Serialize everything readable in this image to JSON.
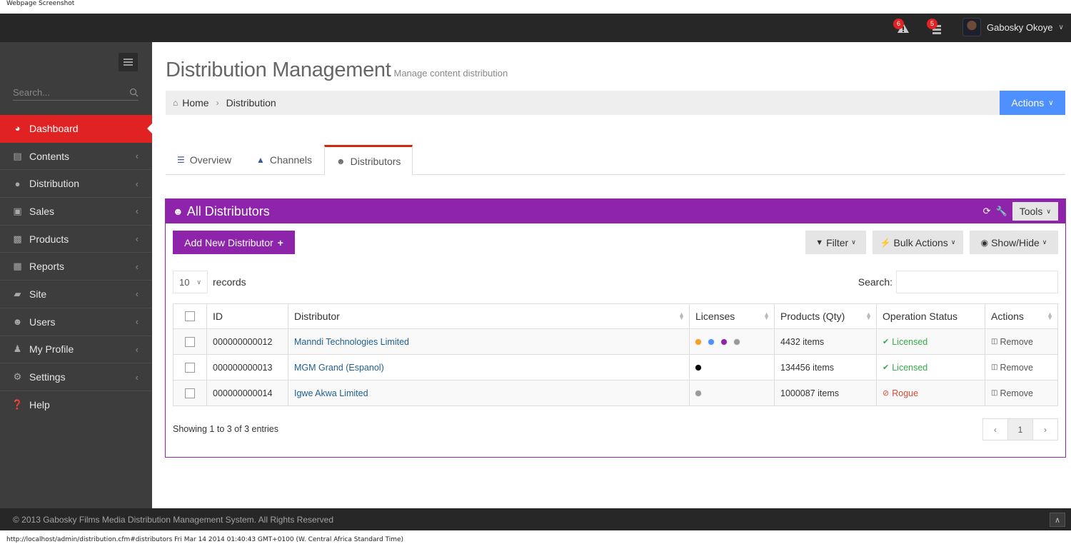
{
  "capture": {
    "top_label": "Webpage Screenshot",
    "bottom_label": "http://localhost/admin/distribution.cfm#distributors Fri Mar 14 2014 01:40:43 GMT+0100 (W. Central Africa Standard Time)"
  },
  "topbar": {
    "alerts_count": "6",
    "messages_count": "5",
    "user_name": "Gabosky Okoye"
  },
  "sidebar": {
    "search_placeholder": "Search...",
    "items": [
      {
        "label": "Dashboard",
        "icon": "dashboard-icon"
      },
      {
        "label": "Contents",
        "icon": "book-icon"
      },
      {
        "label": "Distribution",
        "icon": "globe-icon"
      },
      {
        "label": "Sales",
        "icon": "money-icon"
      },
      {
        "label": "Products",
        "icon": "briefcase-icon"
      },
      {
        "label": "Reports",
        "icon": "bar-chart-icon"
      },
      {
        "label": "Site",
        "icon": "folder-open-icon"
      },
      {
        "label": "Users",
        "icon": "group-icon"
      },
      {
        "label": "My Profile",
        "icon": "user-icon"
      },
      {
        "label": "Settings",
        "icon": "cogs-icon"
      },
      {
        "label": "Help",
        "icon": "question-icon"
      }
    ]
  },
  "page": {
    "title": "Distribution Management",
    "subtitle": "Manage content distribution",
    "breadcrumb": {
      "home": "Home",
      "current": "Distribution"
    },
    "actions_label": "Actions"
  },
  "tabs": [
    {
      "label": "Overview"
    },
    {
      "label": "Channels"
    },
    {
      "label": "Distributors"
    }
  ],
  "portlet": {
    "title": "All Distributors",
    "tools_label": "Tools",
    "add_label": "Add New Distributor",
    "filter_label": "Filter",
    "bulk_label": "Bulk Actions",
    "showhide_label": "Show/Hide",
    "length_value": "10",
    "length_suffix": "records",
    "search_label": "Search:",
    "info": "Showing 1 to 3 of 3 entries",
    "current_page": "1"
  },
  "table": {
    "columns": [
      "ID",
      "Distributor",
      "Licenses",
      "Products (Qty)",
      "Operation Status",
      "Actions"
    ],
    "rows": [
      {
        "id": "000000000012",
        "distributor": "Manndi Technologies Limited",
        "licenses": [
          "#f4a21d",
          "#4d90fe",
          "#8e24aa",
          "#999999"
        ],
        "products": "4432 items",
        "status": "Licensed",
        "action": "Remove"
      },
      {
        "id": "000000000013",
        "distributor": "MGM Grand (Espanol)",
        "licenses": [
          "#000000"
        ],
        "products": "134456 items",
        "status": "Licensed",
        "action": "Remove"
      },
      {
        "id": "000000000014",
        "distributor": "Igwe Akwa Limited",
        "licenses": [
          "#999999"
        ],
        "products": "1000087 items",
        "status": "Rogue",
        "action": "Remove"
      }
    ]
  },
  "footer": {
    "copyright": "© 2013 Gabosky Films Media Distribution Management System. All Rights Reserved"
  },
  "colors": {
    "accent_red": "#e02222",
    "portlet_purple": "#8e24aa",
    "actions_blue": "#4d90fe",
    "licensed_green": "#35aa47",
    "rogue_red": "#d84a38"
  }
}
